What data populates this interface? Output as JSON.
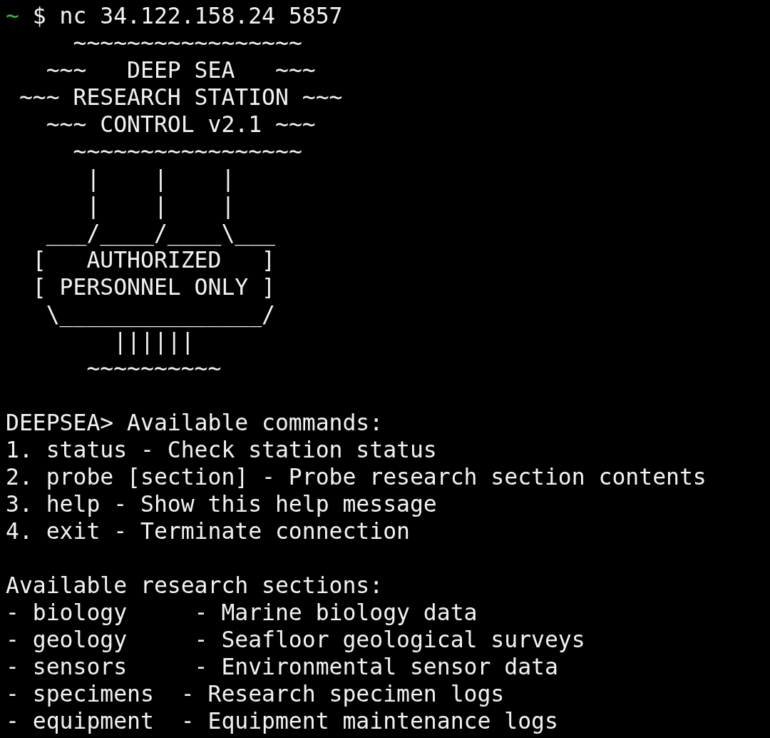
{
  "prompt": {
    "cwd": "~",
    "command": "$ nc 34.122.158.24 5857"
  },
  "banner": [
    "     ~~~~~~~~~~~~~~~~~",
    "   ~~~   DEEP SEA   ~~~",
    " ~~~ RESEARCH STATION ~~~",
    "   ~~~ CONTROL v2.1 ~~~",
    "     ~~~~~~~~~~~~~~~~~",
    "      |    |    |",
    "      |    |    |",
    "   ___/____/____\\___",
    "  [   AUTHORIZED   ]",
    "  [ PERSONNEL ONLY ]",
    "   \\_______________/",
    "        ||||||",
    "      ~~~~~~~~~~"
  ],
  "help": [
    "DEEPSEA> Available commands:",
    "1. status - Check station status",
    "2. probe [section] - Probe research section contents",
    "3. help - Show this help message",
    "4. exit - Terminate connection"
  ],
  "sections": [
    "Available research sections:",
    "- biology     - Marine biology data",
    "- geology     - Seafloor geological surveys",
    "- sensors     - Environmental sensor data",
    "- specimens  - Research specimen logs",
    "- equipment  - Equipment maintenance logs"
  ]
}
